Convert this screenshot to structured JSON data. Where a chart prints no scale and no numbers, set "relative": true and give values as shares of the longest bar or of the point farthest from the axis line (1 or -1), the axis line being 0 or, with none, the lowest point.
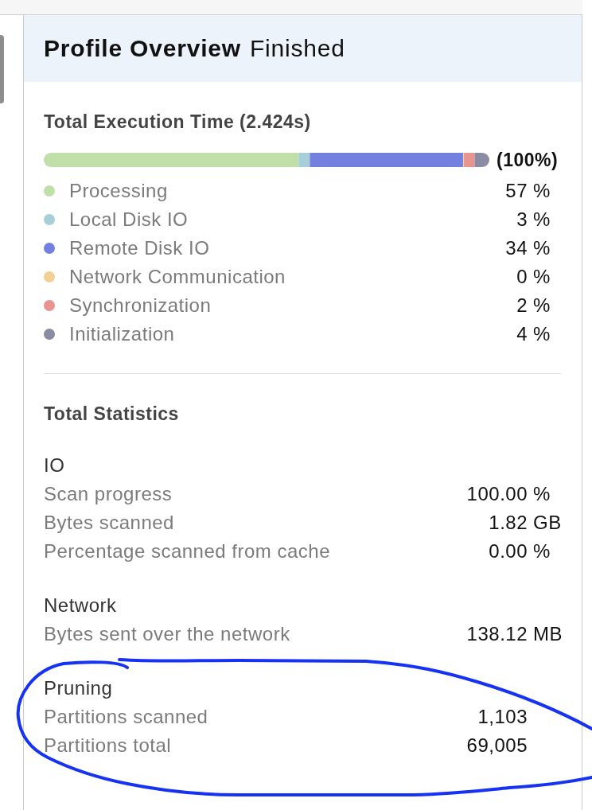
{
  "header": {
    "title": "Profile Overview",
    "status": "Finished"
  },
  "execution_time": {
    "title": "Total Execution Time (2.424s)",
    "total": "(100%)",
    "chart_data": {
      "type": "bar",
      "orientation": "horizontal",
      "stacked": true,
      "relative": true,
      "series": [
        {
          "name": "Processing",
          "color": "#c0dfa9",
          "values": [
            0.572
          ]
        },
        {
          "name": "Local Disk IO",
          "color": "#a6cfd8",
          "values": [
            0.025
          ]
        },
        {
          "name": "Remote Disk IO",
          "color": "#7480e0",
          "values": [
            0.344
          ]
        },
        {
          "name": "Network Communication",
          "color": "#f2d096",
          "values": [
            0.002
          ]
        },
        {
          "name": "Synchronization",
          "color": "#e89592",
          "values": [
            0.024
          ]
        },
        {
          "name": "Initialization",
          "color": "#8a8ca3",
          "values": [
            0.033
          ]
        }
      ]
    },
    "legend_values": [
      {
        "value": "57",
        "unit": "%"
      },
      {
        "value": "3",
        "unit": "%"
      },
      {
        "value": "34",
        "unit": "%"
      },
      {
        "value": "0",
        "unit": "%"
      },
      {
        "value": "2",
        "unit": "%"
      },
      {
        "value": "4",
        "unit": "%"
      }
    ]
  },
  "statistics": {
    "title": "Total Statistics",
    "groups": [
      {
        "title": "IO",
        "highlighted": false,
        "rows": [
          {
            "label": "Scan progress",
            "value": "100.00",
            "unit": "%"
          },
          {
            "label": "Bytes scanned",
            "value": "1.82",
            "unit": "GB"
          },
          {
            "label": "Percentage scanned from cache",
            "value": "0.00",
            "unit": "%"
          }
        ]
      },
      {
        "title": "Network",
        "highlighted": false,
        "rows": [
          {
            "label": "Bytes sent over the network",
            "value": "138.12",
            "unit": "MB"
          }
        ]
      },
      {
        "title": "Pruning",
        "highlighted": true,
        "rows": [
          {
            "label": "Partitions scanned",
            "value": "1,103"
          },
          {
            "label": "Partitions total",
            "value": "69,005"
          }
        ]
      }
    ]
  }
}
